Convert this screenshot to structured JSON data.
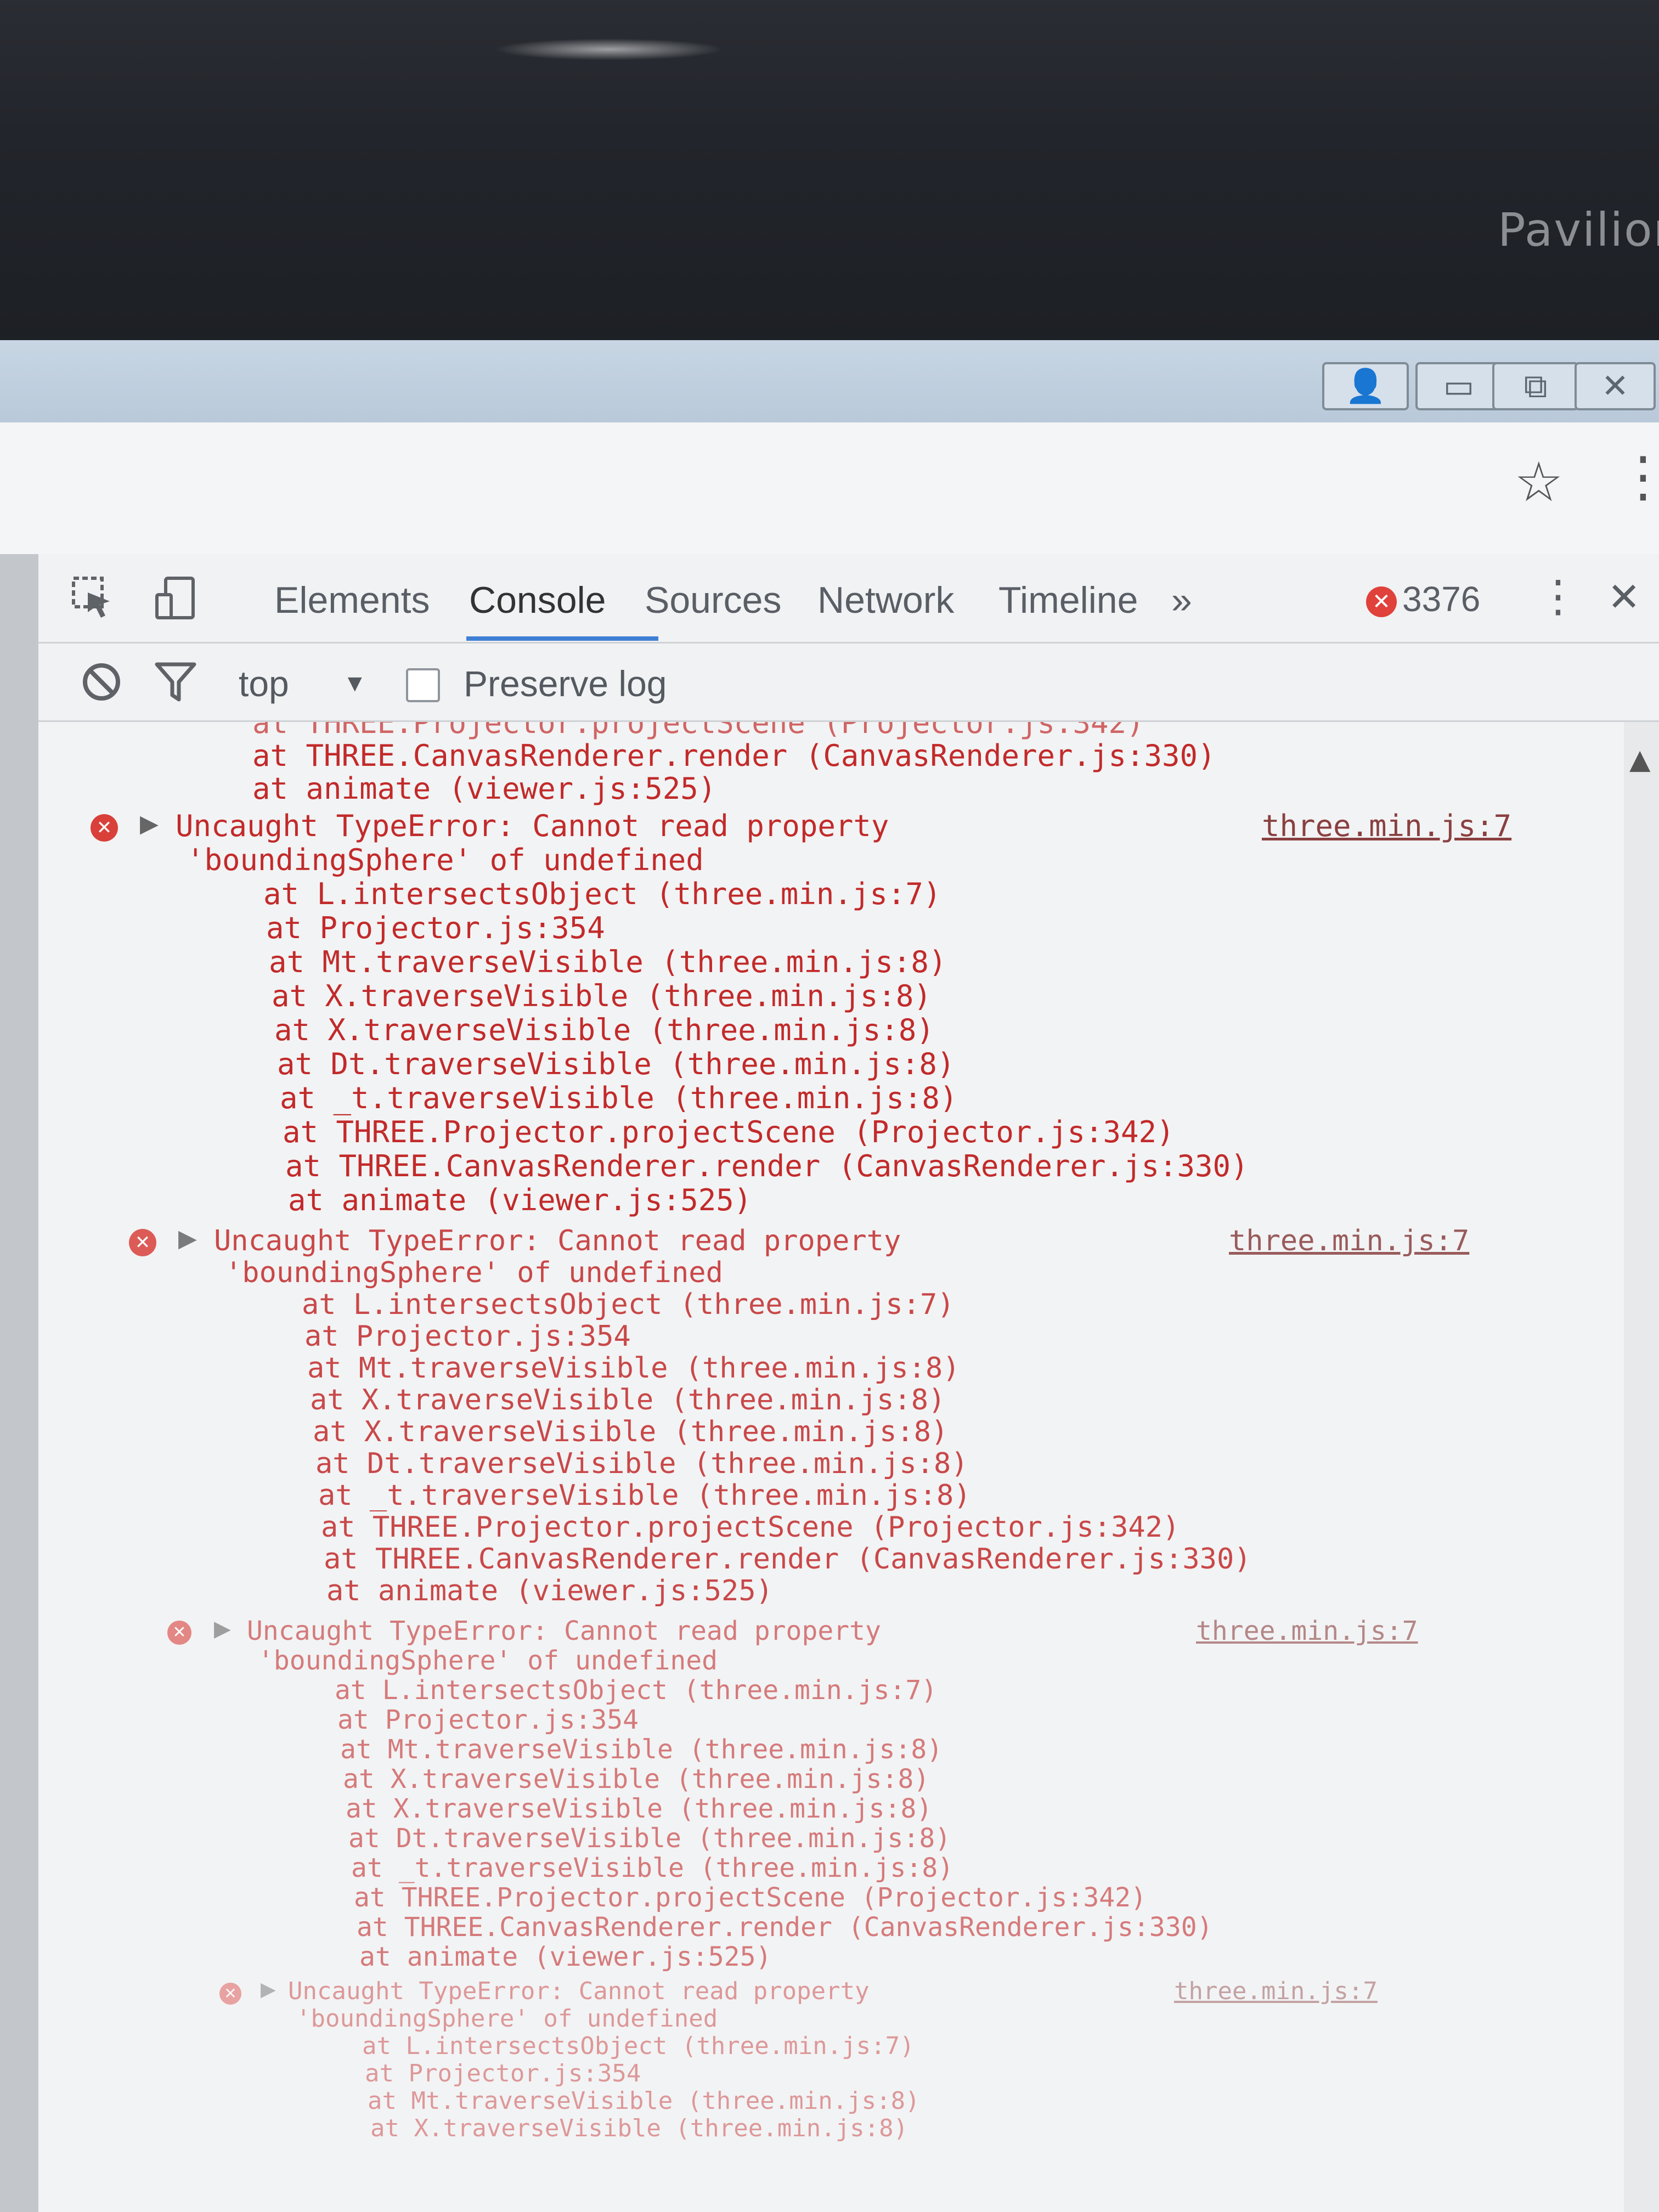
{
  "monitor": {
    "brand": "Pavilion"
  },
  "window": {
    "buttons": {
      "user": "👤",
      "minimize": "▭",
      "restore": "⧉",
      "close": "✕"
    }
  },
  "browser": {
    "star": "☆",
    "menu": "⋮"
  },
  "devtools": {
    "tabs": [
      "Elements",
      "Console",
      "Sources",
      "Network",
      "Timeline"
    ],
    "more": "»",
    "error_count": "3376",
    "menu": "⋮",
    "close": "✕",
    "filter": {
      "context": "top",
      "context_arrow": "▼",
      "preserve_log": "Preserve log"
    }
  },
  "console": {
    "top_lines": [
      "at THREE.CanvasRenderer.render (CanvasRenderer.js:330)",
      "at animate (viewer.js:525)"
    ],
    "errors": [
      {
        "message_line1": "Uncaught TypeError: Cannot read property",
        "message_line2": "'boundingSphere' of undefined",
        "source": "three.min.js:7",
        "stack": [
          "at L.intersectsObject (three.min.js:7)",
          "at Projector.js:354",
          "at Mt.traverseVisible (three.min.js:8)",
          "at X.traverseVisible (three.min.js:8)",
          "at X.traverseVisible (three.min.js:8)",
          "at Dt.traverseVisible (three.min.js:8)",
          "at _t.traverseVisible (three.min.js:8)",
          "at THREE.Projector.projectScene (Projector.js:342)",
          "at THREE.CanvasRenderer.render (CanvasRenderer.js:330)",
          "at animate (viewer.js:525)"
        ]
      },
      {
        "message_line1": "Uncaught TypeError: Cannot read property",
        "message_line2": "'boundingSphere' of undefined",
        "source": "three.min.js:7",
        "stack": [
          "at L.intersectsObject (three.min.js:7)",
          "at Projector.js:354",
          "at Mt.traverseVisible (three.min.js:8)",
          "at X.traverseVisible (three.min.js:8)",
          "at X.traverseVisible (three.min.js:8)",
          "at Dt.traverseVisible (three.min.js:8)",
          "at _t.traverseVisible (three.min.js:8)",
          "at THREE.Projector.projectScene (Projector.js:342)",
          "at THREE.CanvasRenderer.render (CanvasRenderer.js:330)",
          "at animate (viewer.js:525)"
        ]
      },
      {
        "message_line1": "Uncaught TypeError: Cannot read property",
        "message_line2": "'boundingSphere' of undefined",
        "source": "three.min.js:7",
        "stack": [
          "at L.intersectsObject (three.min.js:7)",
          "at Projector.js:354",
          "at Mt.traverseVisible (three.min.js:8)",
          "at X.traverseVisible (three.min.js:8)",
          "at X.traverseVisible (three.min.js:8)",
          "at Dt.traverseVisible (three.min.js:8)",
          "at _t.traverseVisible (three.min.js:8)",
          "at THREE.Projector.projectScene (Projector.js:342)",
          "at THREE.CanvasRenderer.render (CanvasRenderer.js:330)",
          "at animate (viewer.js:525)"
        ]
      },
      {
        "message_line1": "Uncaught TypeError: Cannot read property",
        "message_line2": "'boundingSphere' of undefined",
        "source": "three.min.js:7",
        "stack": [
          "at L.intersectsObject (three.min.js:7)",
          "at Projector.js:354",
          "at Mt.traverseVisible (three.min.js:8)",
          "at X.traverseVisible (three.min.js:8)"
        ]
      }
    ]
  },
  "colors": {
    "error_text": "#c22a2a",
    "error_icon": "#d9403a",
    "active_tab_underline": "#3f80d6"
  }
}
